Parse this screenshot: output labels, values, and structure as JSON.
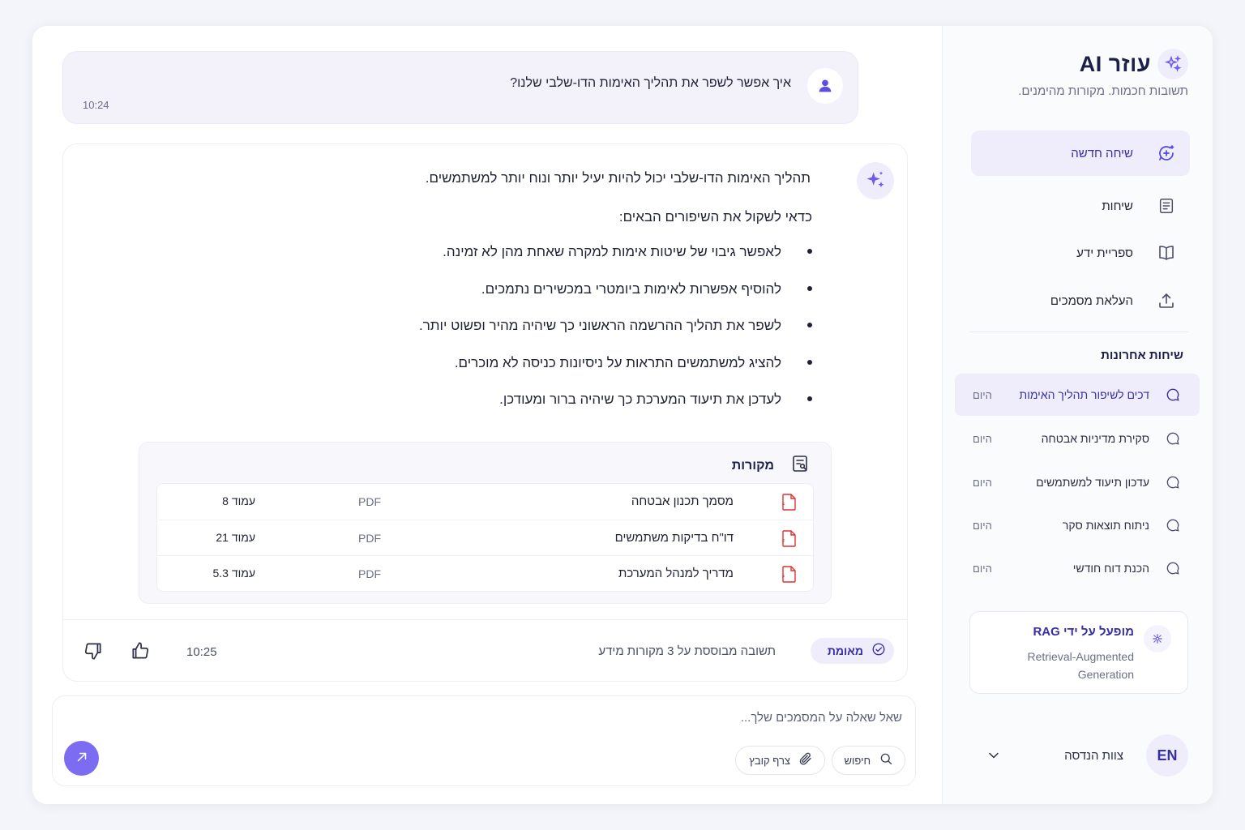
{
  "sidebar": {
    "brand_title": "עוזר AI",
    "brand_subtitle": "תשובות חכמות. מקורות מהימנים.",
    "nav": [
      {
        "label": "שיחה חדשה",
        "icon": "new-chat-icon",
        "active": true
      },
      {
        "label": "שיחות",
        "icon": "conversations-icon",
        "active": false
      },
      {
        "label": "ספריית ידע",
        "icon": "book-icon",
        "active": false
      },
      {
        "label": "העלאת מסמכים",
        "icon": "upload-icon",
        "active": false
      }
    ],
    "recent_title": "שיחות אחרונות",
    "recent": [
      {
        "label": "דכים לשיפור תהליך האימות",
        "time": "היום",
        "active": true
      },
      {
        "label": "סקירת מדיניות אבטחה",
        "time": "היום",
        "active": false
      },
      {
        "label": "עדכון תיעוד למשתמשים",
        "time": "היום",
        "active": false
      },
      {
        "label": "ניתוח תוצאות סקר",
        "time": "היום",
        "active": false
      },
      {
        "label": "הכנת דוח חודשי",
        "time": "היום",
        "active": false
      }
    ],
    "rag": {
      "title": "מופעל על ידי RAG",
      "description": "Retrieval-Augmented Generation"
    },
    "team": {
      "avatar": "EN",
      "name": "צוות הנדסה"
    }
  },
  "user_message": {
    "text": "איך אפשר לשפר את תהליך האימות הדו-שלבי שלנו?",
    "time": "10:24"
  },
  "ai_message": {
    "intro": "תהליך האימות הדו-שלבי יכול להיות יעיל יותר ונוח יותר למשתמשים.",
    "sub": "כדאי לשקול את השיפורים הבאים:",
    "bullets": [
      "לאפשר גיבוי של שיטות אימות למקרה שאחת מהן לא זמינה.",
      "להוסיף אפשרות לאימות ביומטרי במכשירים נתמכים.",
      "לשפר את תהליך ההרשמה הראשוני כך שיהיה מהיר ופשוט יותר.",
      "להציג למשתמשים התראות על ניסיונות כניסה לא מוכרים.",
      "לעדכן את תיעוד המערכת כך שיהיה ברור ומעודכן."
    ],
    "sources_title": "מקורות",
    "sources": [
      {
        "name": "מסמך תכנון אבטחה",
        "type": "PDF",
        "page": "עמוד 8"
      },
      {
        "name": "דו\"ח בדיקות משתמשים",
        "type": "PDF",
        "page": "עמוד 21"
      },
      {
        "name": "מדריך למנהל המערכת",
        "type": "PDF",
        "page": "עמוד 5.3"
      }
    ],
    "verified_label": "מאומת",
    "based_on": "תשובה מבוססת על 3 מקורות מידע",
    "time": "10:25"
  },
  "composer": {
    "placeholder": "שאל שאלה על המסמכים שלך...",
    "search_label": "חיפוש",
    "attach_label": "צרף קובץ"
  },
  "colors": {
    "accent": "#7c6cf2",
    "accent_dark": "#3730a3",
    "accent_soft": "#efedfc",
    "pdf_red": "#e03131"
  }
}
